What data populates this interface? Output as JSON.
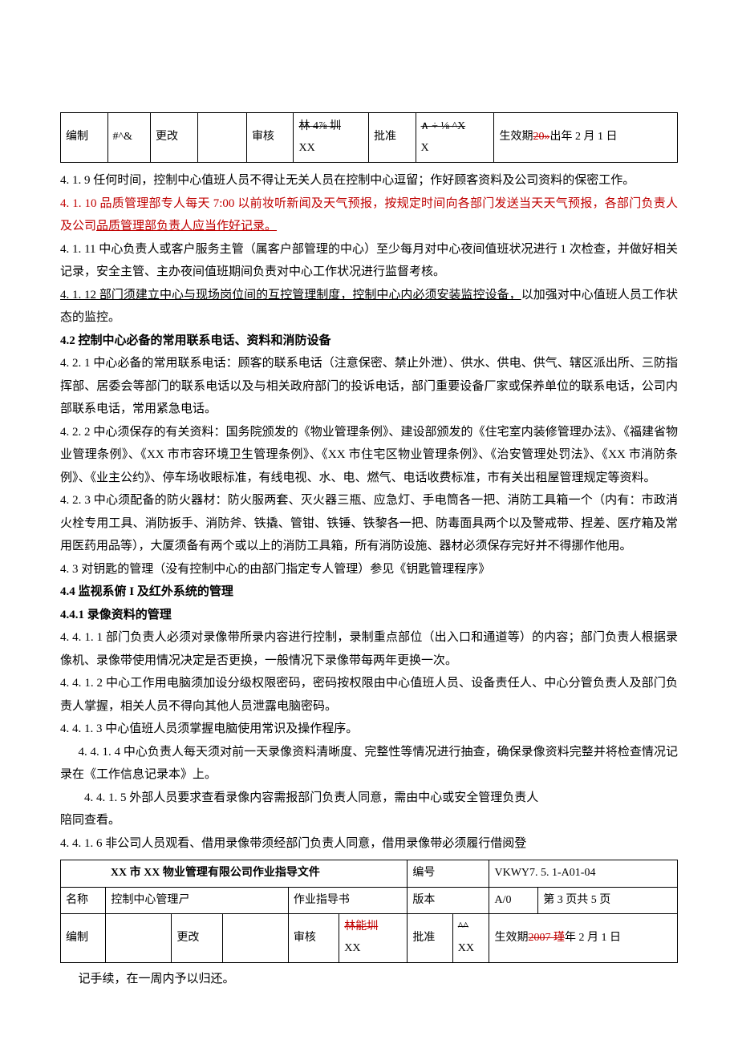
{
  "header_table": {
    "r1c1": "编制",
    "r1c2": "#^&",
    "r1c3": "更改",
    "r1c4": "",
    "r1c5": "审核",
    "r1c6_a": "林 4⅞ 圳",
    "r1c6_b": "XX",
    "r1c7": "批准",
    "r1c8_a": "∧ ÷ ⅛ ^X",
    "r1c8_b": "X",
    "r1c9": "生效期",
    "r1c10": "20»出年 2 月 1 日"
  },
  "body": {
    "p1_a": "4. 1. 9 任何时间，控制中心值班人员不得让无关人员在控制中心逗留；作好顾客资料及公司资料的保密工作。",
    "p2": "4. 1. 10 品质管理部专人每天 7:00 以前妆听新闻及天气预报，按规定时间向各部门发送当天天气预报，各部门负责人及公司品质管理部负责人应当作好记录。",
    "p3": "4. 1. 11 中心负责人或客户服务主管（属客户部管理的中心）至少每月对中心夜间值班状况进行 1 次检查，并做好相关记录，安全主管、主办夜间值班期间负责对中心工作状况进行监督考核。",
    "p4_a": "4. 1. 12 部门须建立中心与现场岗位间的互控管理制度，控制中心内必须安装监控设备，",
    "p4_b": "以加强对中心值班人员工作状态的监控。",
    "h42": "4.2 控制中心必备的常用联系电话、资料和消防设备",
    "p5": "4. 2. 1 中心必备的常用联系电话：顾客的联系电话（注意保密、禁止外泄）、供水、供电、供气、辖区派出所、三防指挥部、居委会等部门的联系电话以及与相关政府部门的投诉电话，部门重要设备厂家或保养单位的联系电话，公司内部联系电话，常用紧急电话。",
    "p6": "4. 2. 2 中心须保存的有关资料：国务院颁发的《物业管理条例》、建设部颁发的《住宅室内装修管理办法》、《福建省物业管理条例》、《XX 市市容环境卫生管理条例》、《XX 市住宅区物业管理条例》、《治安管理处罚法》、《XX 市消防条例》、《业主公约》、停车场收眼标准，有线电视、水、电、燃气、电话收费标准，市有关出租屋管理规定等资料。",
    "p7": "4. 2. 3 中心须配备的防火器材：防火服两套、灭火器三瓶、应急灯、手电筒各一把、消防工具箱一个（内有：市政消火栓专用工具、消防扳手、消防斧、铁撬、管钳、铁锤、铁黎各一把、防毒面具两个以及警戒带、捏差、医疗箱及常用医药用品等），大厦须备有两个或以上的消防工具箱，所有消防设施、器材必须保存完好并不得挪作他用。",
    "p8": "4. 3 对钥匙的管理（没有控制中心的由部门指定专人管理）参见《钥匙管理程序》",
    "h44": "4.4 监视系俯 I 及红外系统的管理",
    "h441": "4.4.1 录像资料的管理",
    "p9": "4. 4. 1. 1 部门负责人必须对录像带所录内容进行控制，录制重点部位（出入口和通道等）的内容；部门负责人根据录像机、录像带使用情况决定是否更换，一般情况下录像带每两年更换一次。",
    "p10": "4. 4. 1. 2 中心工作用电脑须加设分级权限密码，密码按权限由中心值班人员、设备责任人、中心分管负责人及部门负责人掌握，相关人员不得向其他人员泄露电脑密码。",
    "p11": "4. 4. 1. 3 中心值班人员须掌握电脑使用常识及操作程序。",
    "p12": "4. 4. 1. 4 中心负责人每天须对前一天录像资料清晰度、完整性等情况进行抽查，确保录像资料完整并将检查情况记录在《工作信息记录本》上。",
    "p13a": "4. 4. 1. 5 外部人员要求查看录像内容需报部门负责人同意，需由中心或安全管理负责人",
    "p13b": "陪同查看。",
    "p14": "4. 4. 1. 6 非公司人员观看、借用录像带须经部门负责人同意，借用录像带必须履行借阅登"
  },
  "footer_table": {
    "r0c1": "XX 市 XX 物业管理有限公司作业指导文件",
    "r0c2": "编号",
    "r0c3": "VKWY7. 5. 1-A01-04",
    "r1c1": "名称",
    "r1c2": "控制中心管理ㄕ",
    "r1c3": "作业指导书",
    "r1c4": "版本",
    "r1c5": "A/0",
    "r1c6": "第 3 页共 5 页",
    "r2c1": "编制",
    "r2c2": "",
    "r2c3": "更改",
    "r2c4": "",
    "r2c5": "审核",
    "r2c6a": "林能圳",
    "r2c6b": "XX",
    "r2c7": "批准",
    "r2c8a": "^^",
    "r2c8b": "XX",
    "r2c9": "生效期",
    "r2c10": "2007 瑾年 2 月 1 日"
  },
  "tail": "记手续，在一周内予以归还。"
}
